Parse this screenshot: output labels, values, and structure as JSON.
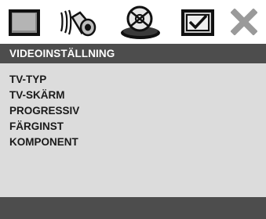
{
  "icon_bar": {
    "icons": [
      {
        "name": "tv-setup-icon"
      },
      {
        "name": "audio-setup-icon"
      },
      {
        "name": "disc-setup-icon",
        "selected": true
      },
      {
        "name": "preferences-icon"
      },
      {
        "name": "close-icon"
      }
    ]
  },
  "page": {
    "title": "VIDEOINSTÄLLNING"
  },
  "menu": {
    "items": [
      {
        "label": "TV-TYP"
      },
      {
        "label": "TV-SKÄRM"
      },
      {
        "label": "PROGRESSIV"
      },
      {
        "label": "FÄRGINST"
      },
      {
        "label": "KOMPONENT"
      }
    ]
  },
  "colors": {
    "header_bg": "#4d4d4d",
    "content_bg": "#dcdcdc",
    "footer_bg": "#4d4d4d",
    "text": "#1a1a1a",
    "header_text": "#ffffff",
    "close_icon": "#9a9a9a"
  }
}
